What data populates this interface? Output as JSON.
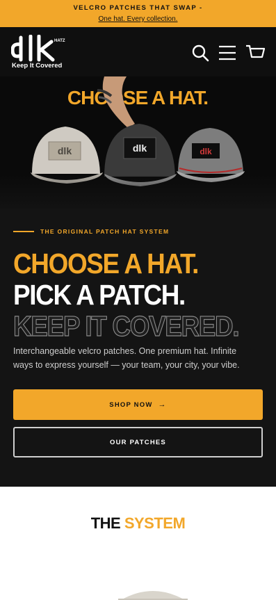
{
  "announcement": {
    "line1": "VELCRO PATCHES THAT SWAP -",
    "line2": "One hat. Every collection."
  },
  "header": {
    "logo_text": "dlk",
    "logo_small": "HATZ",
    "logo_tagline": "Keep It Covered",
    "icons": [
      "search-icon",
      "menu-icon",
      "cart-icon"
    ]
  },
  "hero": {
    "image_overlay_text": "CHOOSE A HAT.",
    "hat_patch_text": "dlk",
    "eyebrow": "THE ORIGINAL PATCH HAT SYSTEM",
    "headline": {
      "line1": "CHOOSE A HAT.",
      "line2": "PICK A PATCH.",
      "line3": "KEEP IT COVERED."
    },
    "description": "Interchangeable velcro patches. One premium hat. Infinite ways to express yourself — your team, your city, your vibe.",
    "primary_button": "SHOP NOW",
    "primary_button_icon": "arrow-right-icon",
    "secondary_button": "OUR PATCHES"
  },
  "system_section": {
    "title_part1": "THE",
    "title_part2": "SYSTEM"
  },
  "colors": {
    "accent": "#f2a72a",
    "dark": "#141414",
    "header": "#0f0f0f"
  }
}
